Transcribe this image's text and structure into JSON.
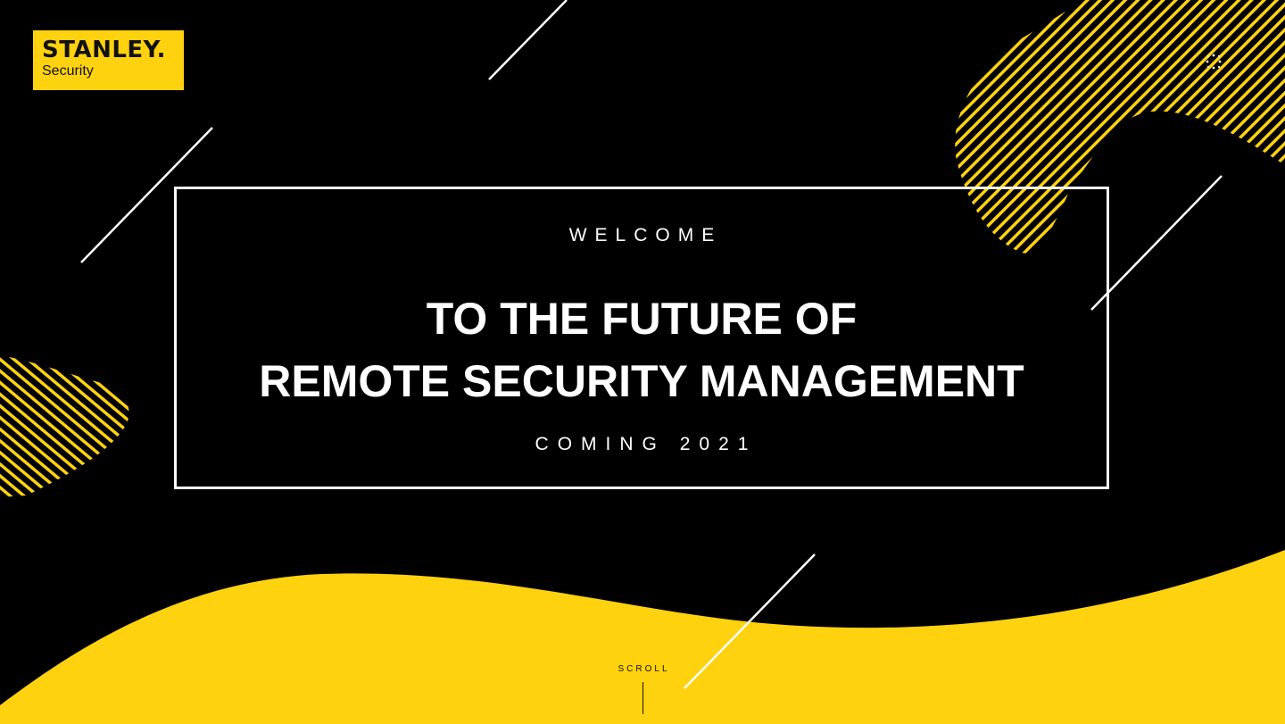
{
  "logo": {
    "brand": "STANLEY.",
    "sub": "Security"
  },
  "menu": {
    "icon": "dots-grid-icon"
  },
  "hero": {
    "welcome": "WELCOME",
    "headline_line1": "TO THE FUTURE OF",
    "headline_line2": "REMOTE SECURITY MANAGEMENT",
    "coming": "COMING 2021"
  },
  "scroll": {
    "label": "SCROLL"
  },
  "colors": {
    "background": "#000000",
    "accent": "#FFD20F",
    "text": "#FFFFFF"
  }
}
